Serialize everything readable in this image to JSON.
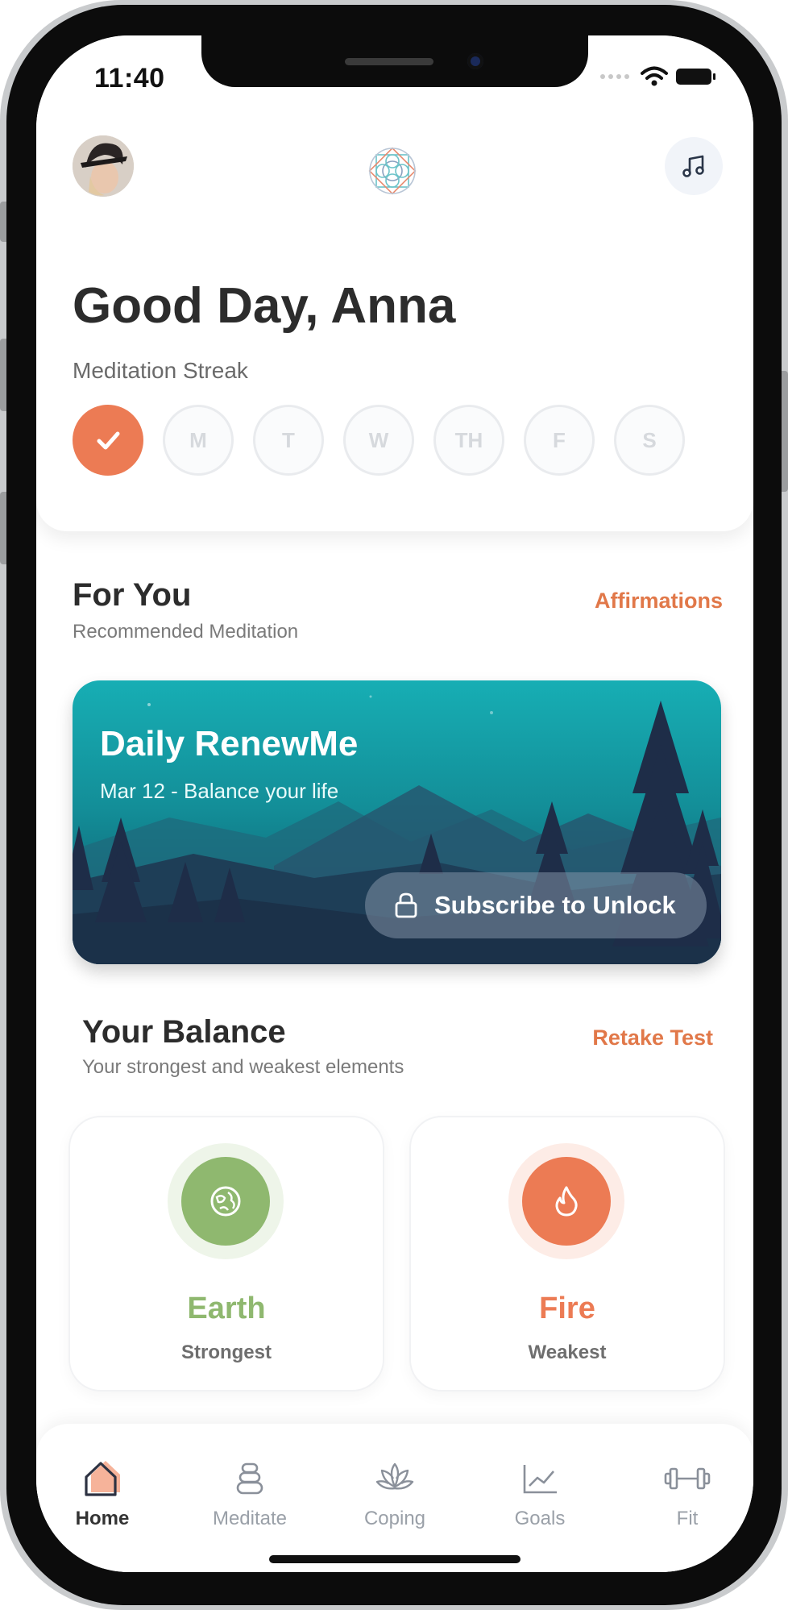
{
  "status_bar": {
    "time": "11:40"
  },
  "header": {
    "greeting": "Good Day, Anna",
    "streak_label": "Meditation Streak",
    "streak_days": [
      {
        "label": "",
        "done": true
      },
      {
        "label": "M",
        "done": false
      },
      {
        "label": "T",
        "done": false
      },
      {
        "label": "W",
        "done": false
      },
      {
        "label": "TH",
        "done": false
      },
      {
        "label": "F",
        "done": false
      },
      {
        "label": "S",
        "done": false
      }
    ]
  },
  "for_you": {
    "title": "For You",
    "subtitle": "Recommended Meditation",
    "link": "Affirmations",
    "card": {
      "title": "Daily RenewMe",
      "subtitle": "Mar 12 - Balance your life",
      "button_label": "Subscribe to Unlock"
    }
  },
  "balance": {
    "title": "Your Balance",
    "subtitle": "Your strongest and weakest elements",
    "link": "Retake Test",
    "items": [
      {
        "name": "Earth",
        "state": "Strongest",
        "color": "#8fb86f",
        "icon": "earth-icon"
      },
      {
        "name": "Fire",
        "state": "Weakest",
        "color": "#ec7b54",
        "icon": "fire-icon"
      }
    ]
  },
  "tabs": [
    {
      "label": "Home",
      "icon": "home-icon",
      "active": true
    },
    {
      "label": "Meditate",
      "icon": "stones-icon",
      "active": false
    },
    {
      "label": "Coping",
      "icon": "lotus-icon",
      "active": false
    },
    {
      "label": "Goals",
      "icon": "chart-icon",
      "active": false
    },
    {
      "label": "Fit",
      "icon": "dumbbell-icon",
      "active": false
    }
  ],
  "colors": {
    "accent": "#ec7b54",
    "link": "#e17849",
    "earth": "#8fb86f",
    "teal": "#17aeb4"
  }
}
